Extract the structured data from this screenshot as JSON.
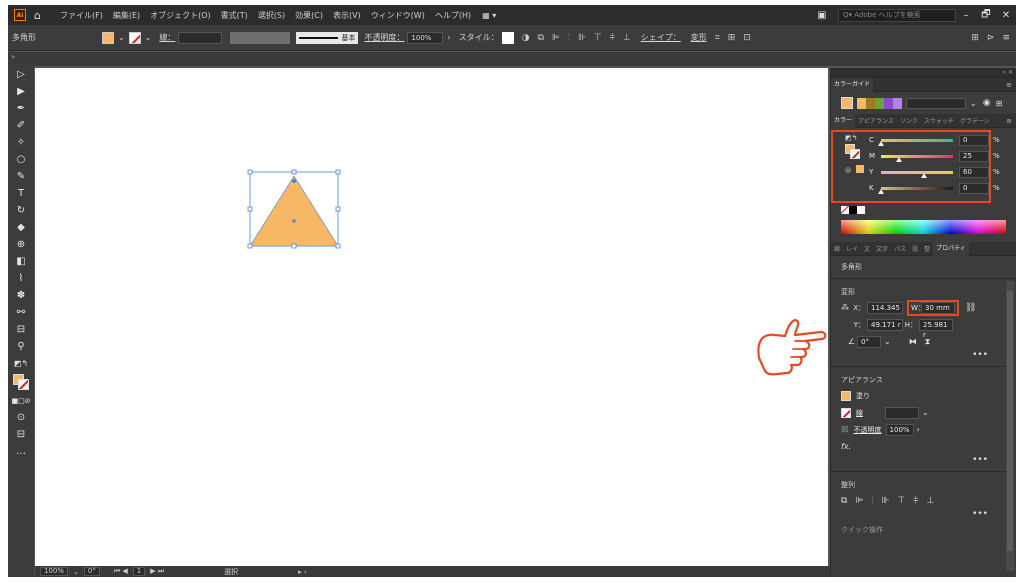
{
  "app": {
    "logo_text": "Ai",
    "menu": [
      "ファイル(F)",
      "編集(E)",
      "オブジェクト(O)",
      "書式(T)",
      "選択(S)",
      "効果(C)",
      "表示(V)",
      "ウィンドウ(W)",
      "ヘルプ(H)"
    ],
    "layout_switch": "▦ ▾",
    "search_placeholder": "Q▾ Adobe ヘルプを検索",
    "window_buttons": [
      "–",
      "🗗",
      "✕"
    ]
  },
  "control_bar": {
    "selection_label": "多角形",
    "stroke_label": "線：",
    "stroke_profile_label": "基本",
    "opacity_label": "不透明度：",
    "opacity_value": "100%",
    "style_label": "スタイル：",
    "shape_link": "シェイプ：",
    "transform_link": "変形"
  },
  "status_bar": {
    "zoom": "100%",
    "rotation": "0°",
    "artboard": "1",
    "tool": "選択"
  },
  "panels": {
    "color_guide_tab": "カラーガイド",
    "color_tabs": [
      "カラー",
      "アピアランス",
      "リンク",
      "スウォッチ",
      "グラデーシ"
    ],
    "props_tabs": [
      "線",
      "レイ",
      "文",
      "文字",
      "パス",
      "段",
      "整",
      "プロパティ"
    ],
    "cmyk": [
      {
        "label": "C",
        "value": "0",
        "fraction": 0.0
      },
      {
        "label": "M",
        "value": "25",
        "fraction": 0.25
      },
      {
        "label": "Y",
        "value": "60",
        "fraction": 0.6
      },
      {
        "label": "K",
        "value": "0",
        "fraction": 0.0
      }
    ],
    "percent": "%",
    "properties": {
      "object_type": "多角形",
      "transform_title": "変形",
      "x_label": "X：",
      "x_value": "114.345",
      "y_label": "Y：",
      "y_value": "49.171 r",
      "w_label": "W：",
      "w_value": "30 mm",
      "h_label": "H：",
      "h_value": "25.981 r",
      "angle_value": "0°",
      "appearance_title": "アピアランス",
      "fill_label": "塗り",
      "stroke_label": "線",
      "opacity_label": "不透明度",
      "opacity_value": "100%",
      "fx_label": "fx.",
      "align_title": "整列",
      "quick_actions": "クイック操作"
    }
  },
  "colors": {
    "fill": "#f5b867",
    "highlight": "#e64b1f",
    "selection": "#4a7fd8"
  }
}
